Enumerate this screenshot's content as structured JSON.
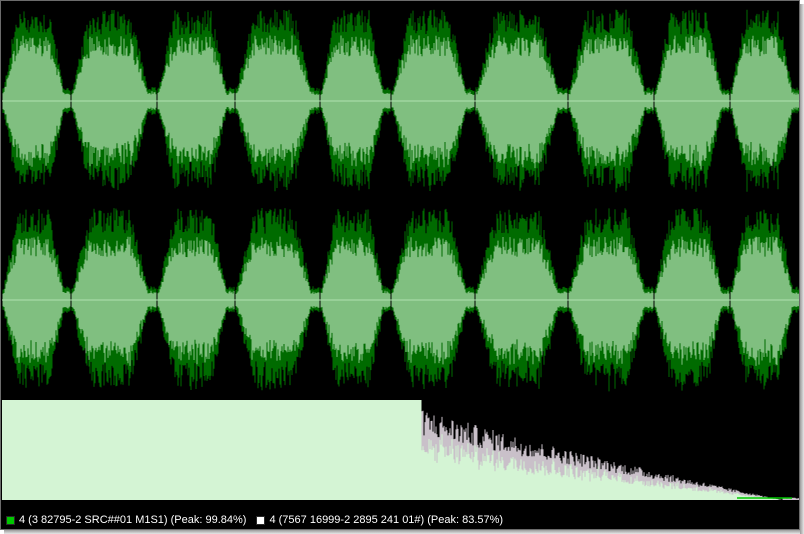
{
  "colors": {
    "background": "#000000",
    "wave_outer": "#006b00",
    "wave_inner": "#80bf80",
    "center_line": "#b0e0b0",
    "spectrum_fill": "#d4f4d4",
    "spectrum_tail": "#c9c0c9",
    "legend_green": "#00c800",
    "legend_white": "#ffffff"
  },
  "waveform": {
    "channel_count": 2,
    "segment_count": 10
  },
  "legend": {
    "items": [
      {
        "label": "4 (3 82795-2 SRC##01 M1S1) (Peak: 99.84%)",
        "color": "#00c800",
        "icon": "green-square-icon"
      },
      {
        "label": "4 (7567 16999-2 2895 241 01#) (Peak: 83.57%)",
        "color": "#ffffff",
        "icon": "white-square-icon"
      }
    ]
  }
}
